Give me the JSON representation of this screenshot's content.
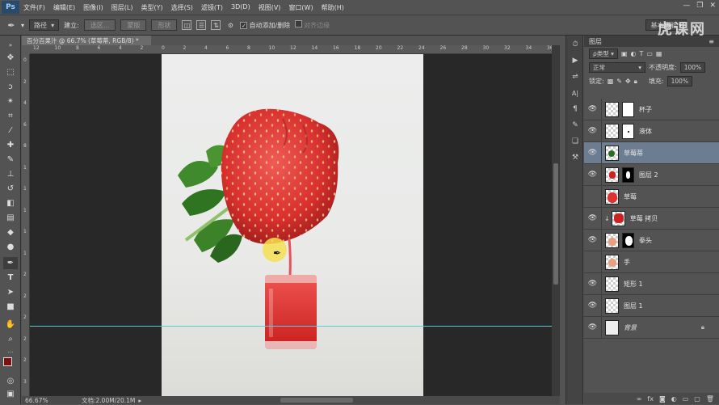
{
  "app": {
    "logo": "Ps"
  },
  "menu": [
    "文件(F)",
    "编辑(E)",
    "图像(I)",
    "图层(L)",
    "类型(Y)",
    "选择(S)",
    "滤镜(T)",
    "3D(D)",
    "视图(V)",
    "窗口(W)",
    "帮助(H)"
  ],
  "window_controls": [
    "—",
    "❐",
    "✕"
  ],
  "options": {
    "mode": "路径",
    "build_label": "建立:",
    "selection_btn": "选区...",
    "mask_btn": "蒙版",
    "shape_btn": "形状",
    "auto_add": "自动添加/删除",
    "align_edges": "对齐边缘",
    "workspace": "基本功能"
  },
  "watermark": "虎课网",
  "document": {
    "tab": "百分百果汁 @ 66.7% (草莓蒂, RGB/8) *",
    "zoom": "66.67%",
    "docsize": "文档:2.00M/20.1M"
  },
  "ruler_top": [
    "12",
    "10",
    "8",
    "6",
    "4",
    "2",
    "0",
    "2",
    "4",
    "6",
    "8",
    "10",
    "12",
    "14",
    "16",
    "18",
    "20",
    "22",
    "24",
    "26",
    "28",
    "30",
    "32",
    "34",
    "36"
  ],
  "ruler_left": [
    "0",
    "2",
    "4",
    "6",
    "8",
    "1",
    "1",
    "1",
    "1",
    "1",
    "2",
    "2",
    "2",
    "2",
    "2",
    "3"
  ],
  "layers_panel": {
    "header": "图层",
    "filter": "ρ类型",
    "blend": "正常",
    "opacity_label": "不透明度:",
    "opacity": "100%",
    "lock_label": "锁定:",
    "fill_label": "填充:",
    "fill": "100%",
    "layers": [
      {
        "name": "杯子",
        "visible": true,
        "mask": "white",
        "active": false
      },
      {
        "name": "液体",
        "visible": true,
        "mask": "white-dot",
        "active": false
      },
      {
        "name": "草莓蒂",
        "visible": true,
        "mask": "none",
        "active": true
      },
      {
        "name": "图层 2",
        "visible": true,
        "mask": "black",
        "active": false
      },
      {
        "name": "草莓",
        "visible": false,
        "mask": "none",
        "active": false
      },
      {
        "name": "草莓 拷贝",
        "visible": true,
        "mask": "none",
        "active": false
      },
      {
        "name": "拳头",
        "visible": true,
        "mask": "hand",
        "active": false
      },
      {
        "name": "手",
        "visible": false,
        "mask": "none",
        "active": false
      },
      {
        "name": "矩形 1",
        "visible": true,
        "mask": "none",
        "active": false
      },
      {
        "name": "图层 1",
        "visible": true,
        "mask": "none",
        "active": false
      },
      {
        "name": "背景",
        "visible": true,
        "mask": "none",
        "active": false,
        "locked": true
      }
    ],
    "footer_icons": [
      "link-icon",
      "fx-icon",
      "mask-icon",
      "adjust-icon",
      "folder-icon",
      "new-layer-icon",
      "trash-icon"
    ]
  }
}
